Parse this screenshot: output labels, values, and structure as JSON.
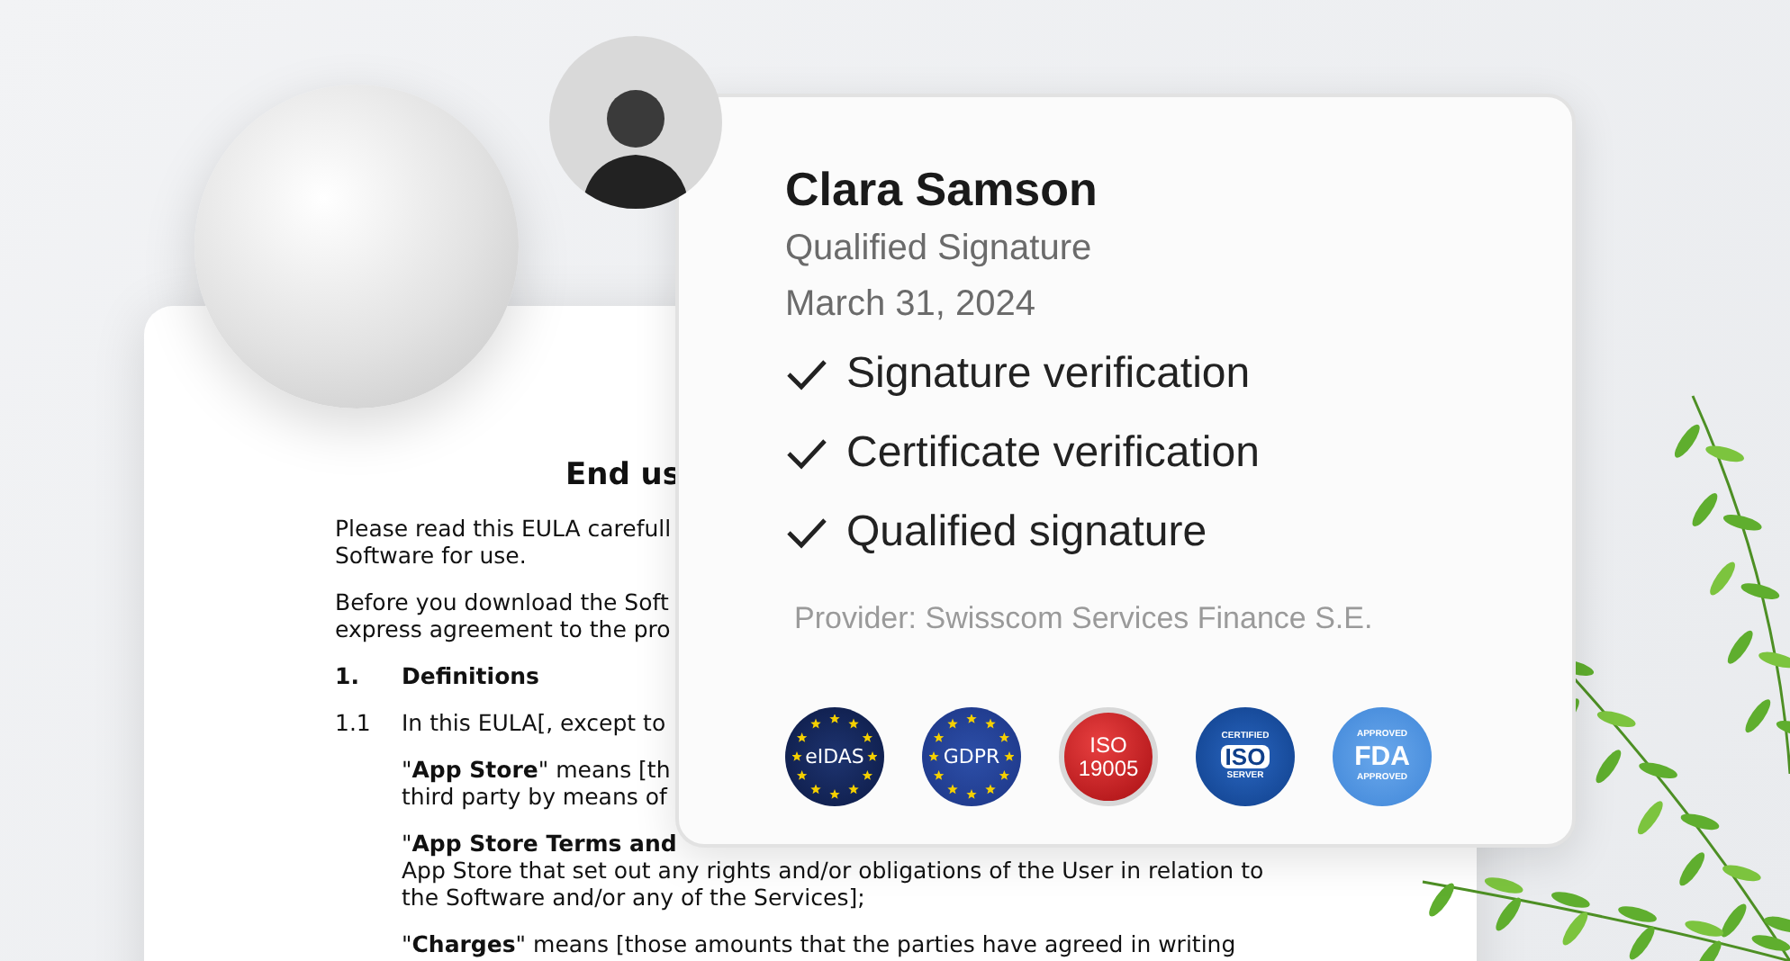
{
  "document": {
    "title": "End us",
    "blocks": [
      {
        "kind": "para",
        "lines": [
          "Please read this EULA carefull",
          "Software for use."
        ]
      },
      {
        "kind": "para",
        "lines": [
          "Before you download the Soft",
          "express agreement to the pro"
        ]
      },
      {
        "kind": "heading",
        "number": "1.",
        "text": "Definitions"
      },
      {
        "kind": "clause",
        "number": "1.1",
        "text": "In this EULA[, except to"
      },
      {
        "kind": "definition",
        "lines": [
          "\"**App Store**\" means [th",
          "third party by means of"
        ]
      },
      {
        "kind": "definition",
        "lines": [
          "\"**App Store Terms and**",
          "App Store that set out any rights and/or obligations of the User in relation to",
          "the Software and/or any of the Services];"
        ]
      },
      {
        "kind": "definition",
        "lines": [
          "\"**Charges**\" means [those amounts that the parties have agreed in writing"
        ]
      }
    ]
  },
  "signature": {
    "name": "Clara Samson",
    "type": "Qualified Signature",
    "date": "March 31, 2024",
    "checks": [
      {
        "label": "Signature verification",
        "checked": true
      },
      {
        "label": "Certificate verification",
        "checked": true
      },
      {
        "label": "Qualified signature",
        "checked": true
      }
    ],
    "provider": "Provider: Swisscom Services Finance S.E.",
    "badges": [
      {
        "kind": "eu",
        "texts": [
          "eIDAS"
        ]
      },
      {
        "kind": "eu",
        "texts": [
          "GDPR"
        ]
      },
      {
        "kind": "red",
        "texts": [
          "ISO",
          "19005"
        ]
      },
      {
        "kind": "certified",
        "texts": [
          "CERTIFIED",
          "ISO",
          "SERVER"
        ]
      },
      {
        "kind": "approved",
        "texts": [
          "APPROVED",
          "FDA",
          "APPROVED"
        ]
      }
    ]
  }
}
